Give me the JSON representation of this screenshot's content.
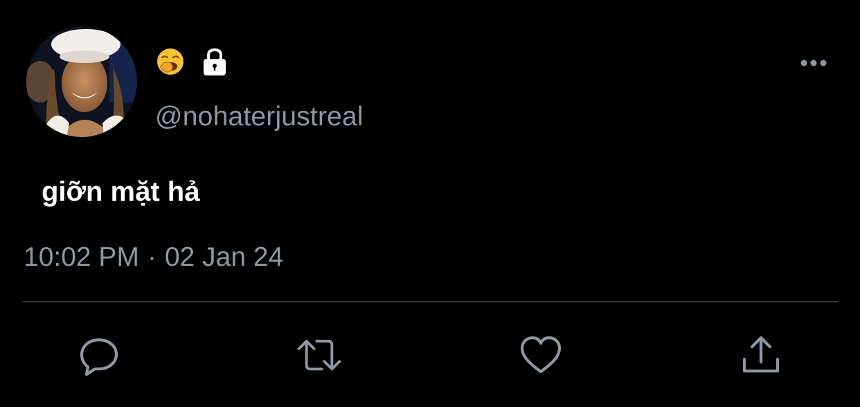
{
  "tweet": {
    "handle": "@nohaterjustreal",
    "text": "giỡn mặt hả",
    "time": "10:02 PM",
    "separator": "·",
    "date": "02 Jan 24"
  },
  "icons": {
    "emoji": "yawning-face-emoji",
    "protected": "lock-icon",
    "more": "more-horizontal-icon",
    "reply": "reply-icon",
    "retweet": "retweet-icon",
    "like": "heart-icon",
    "share": "share-icon"
  },
  "colors": {
    "background": "#000000",
    "text": "#ffffff",
    "secondary_text": "#8b98a5",
    "divider": "#2f3336"
  }
}
